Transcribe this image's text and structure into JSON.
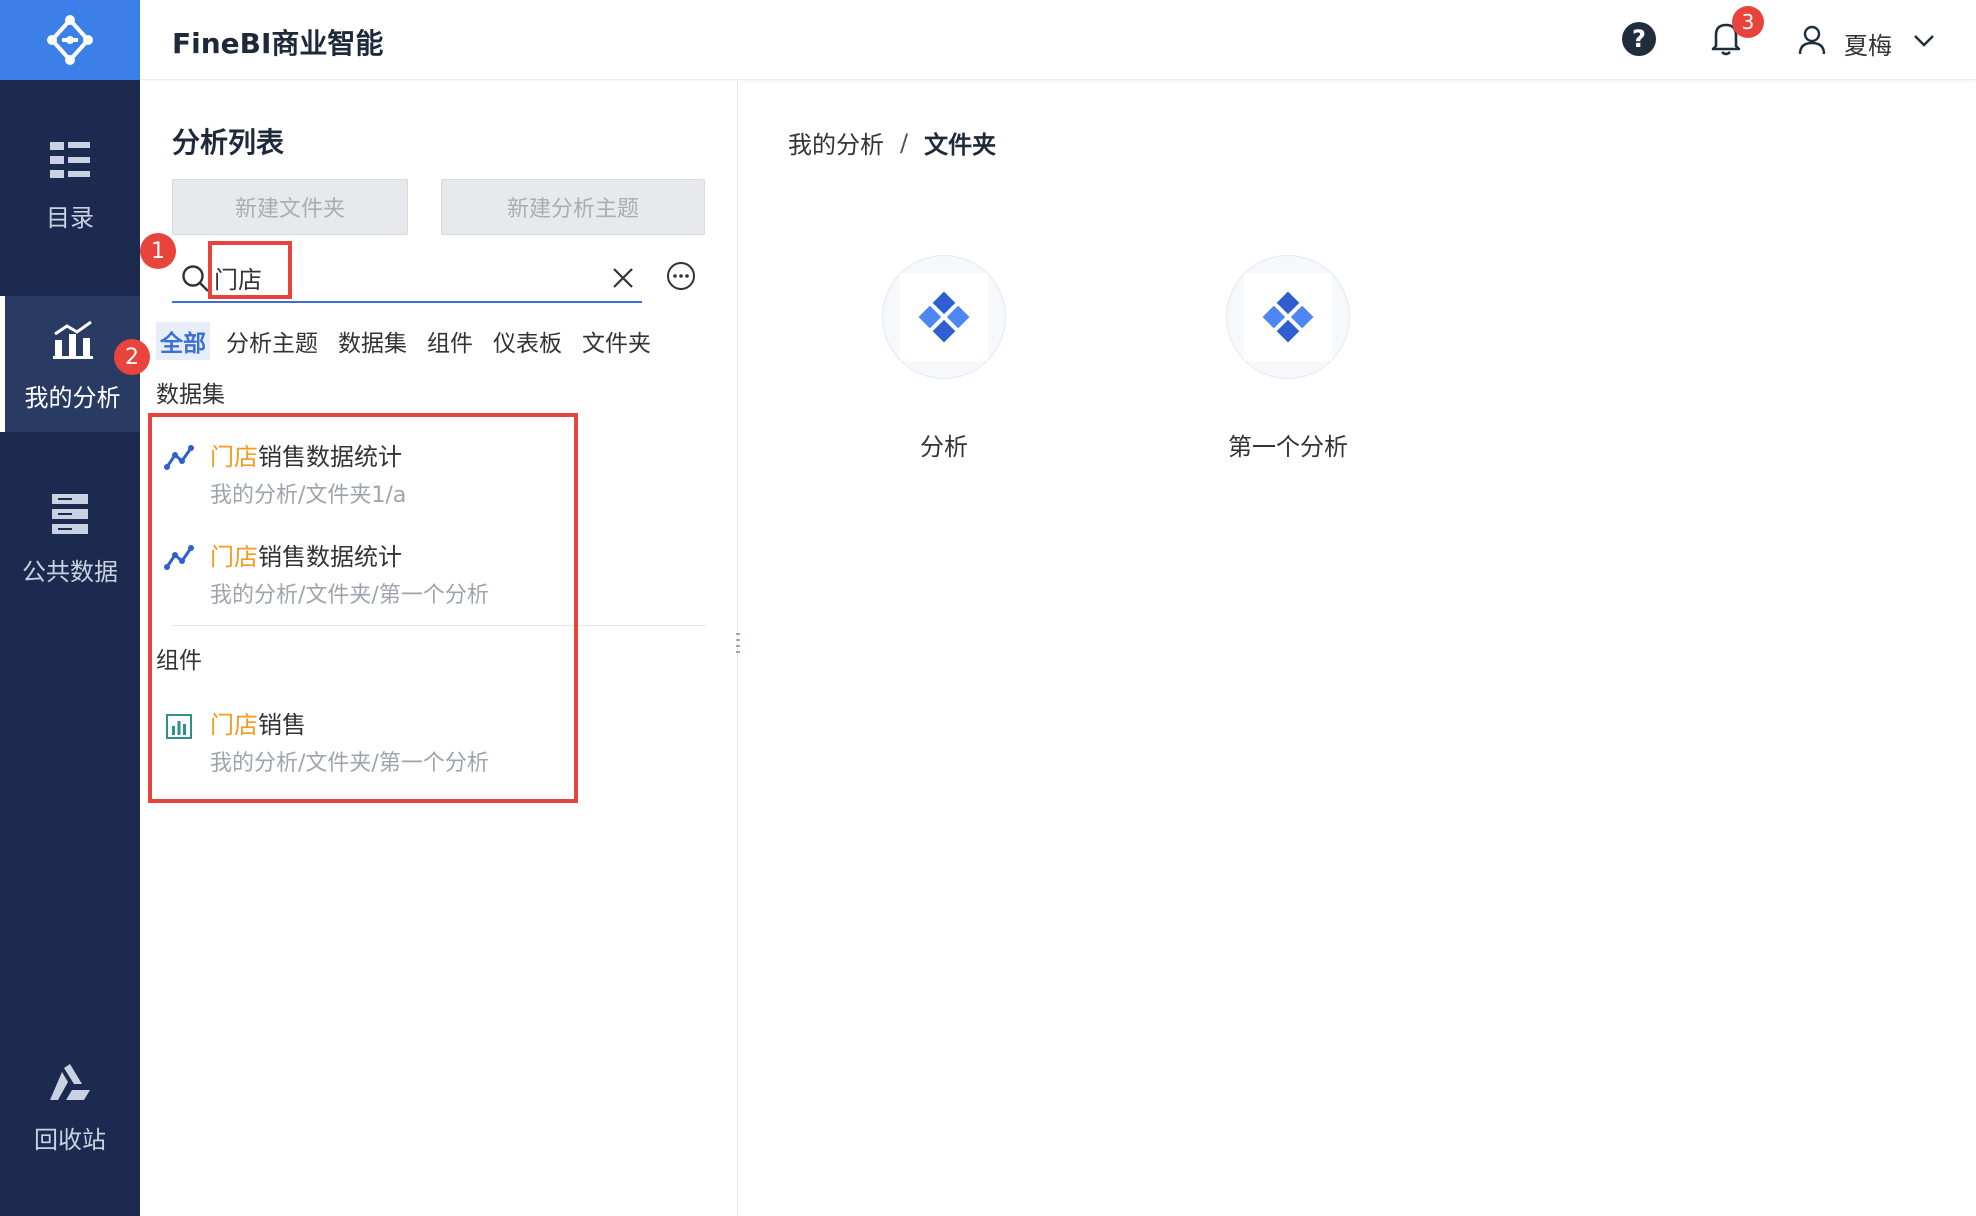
{
  "app": {
    "title": "FineBI商业智能"
  },
  "topbar": {
    "notification_count": "3",
    "user_name": "夏梅",
    "help_label": "?"
  },
  "nav": {
    "items": [
      {
        "label": "目录",
        "icon": "catalog-icon"
      },
      {
        "label": "我的分析",
        "icon": "analysis-chart-icon"
      },
      {
        "label": "公共数据",
        "icon": "public-data-icon"
      },
      {
        "label": "回收站",
        "icon": "recycle-bin-icon"
      }
    ]
  },
  "panel": {
    "title": "分析列表",
    "new_folder": "新建文件夹",
    "new_subject": "新建分析主题",
    "search": {
      "value": "门店"
    },
    "filters": [
      "全部",
      "分析主题",
      "数据集",
      "组件",
      "仪表板",
      "文件夹"
    ],
    "results": {
      "dataset_label": "数据集",
      "datasets": [
        {
          "highlight": "门店",
          "rest": "销售数据统计",
          "path": "我的分析/文件夹1/a"
        },
        {
          "highlight": "门店",
          "rest": "销售数据统计",
          "path": "我的分析/文件夹/第一个分析"
        }
      ],
      "component_label": "组件",
      "components": [
        {
          "highlight": "门店",
          "rest": "销售",
          "path": "我的分析/文件夹/第一个分析"
        }
      ]
    },
    "steps": [
      "1",
      "2"
    ]
  },
  "content": {
    "breadcrumb": {
      "root": "我的分析",
      "separator": "/",
      "current": "文件夹"
    },
    "items": [
      {
        "name": "分析"
      },
      {
        "name": "第一个分析"
      }
    ]
  },
  "colors": {
    "accent": "#3b6fd6",
    "highlight": "#f59a23",
    "annotation": "#e8443b",
    "nav_bg": "#1b2a4e"
  }
}
